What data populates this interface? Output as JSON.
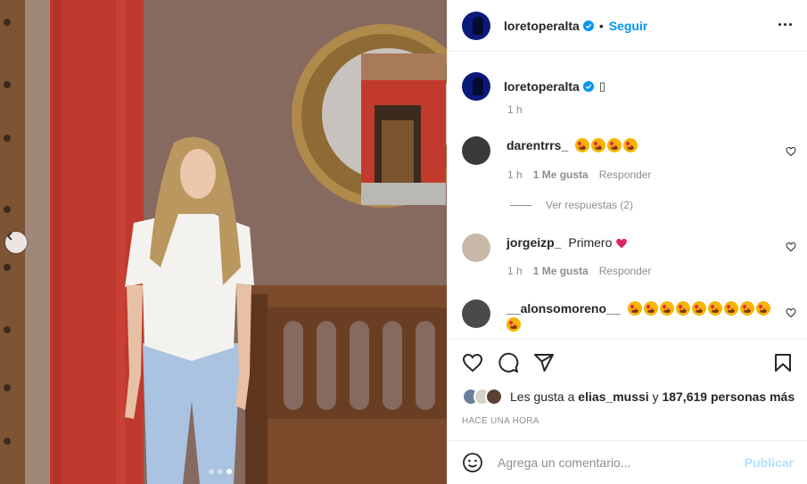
{
  "post": {
    "username": "loretoperalta",
    "separator": "•",
    "follow_label": "Seguir",
    "caption_text": "▯",
    "caption_time": "1 h"
  },
  "comments": [
    {
      "username": "darentrrs_",
      "emoji_count": 4,
      "time": "1 h",
      "likes": "1 Me gusta",
      "reply": "Responder",
      "view_replies": "Ver respuestas (2)"
    },
    {
      "username": "jorgeizp_",
      "text": "Primero",
      "time": "1 h",
      "likes": "1 Me gusta",
      "reply": "Responder"
    },
    {
      "username": "__alonsomoreno__",
      "emoji_count": 10
    }
  ],
  "likes": {
    "prefix": "Les gusta a",
    "user": "elias_mussi",
    "middle": "y",
    "count": "187,619 personas más"
  },
  "timestamp": "HACE UNA HORA",
  "composer": {
    "placeholder": "Agrega un comentario...",
    "post_label": "Publicar"
  },
  "carousel": {
    "total": 3,
    "active": 3
  },
  "colors": {
    "accent": "#0095f6",
    "post_disabled": "#b2dffc",
    "heart": "#ed4956"
  }
}
